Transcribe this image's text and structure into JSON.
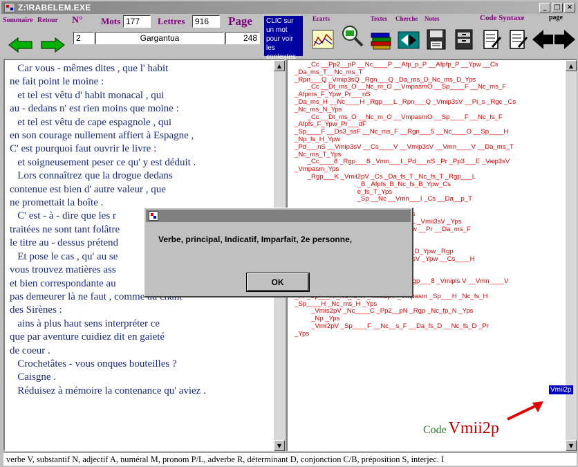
{
  "window": {
    "title": "Z:\\RABELEM.EXE",
    "controls": [
      "_",
      "□",
      "×"
    ]
  },
  "toolbar": {
    "sommaire_label": "Sommaire",
    "retour_label": "Retour",
    "numero_label": "N°",
    "mots_label": "Mots",
    "mots_value": "177",
    "lettres_label": "Lettres",
    "lettres_value": "916",
    "page_label": "Page",
    "numero_value": "2",
    "book_value": "Gargantua",
    "page_value": "248",
    "clic_text": "CLIC sur un mot pour voir les contextes",
    "ecarts_label": "Ecarts",
    "textes_label": "Textes",
    "cherche_label": "Cherche",
    "notes_label": "Notes",
    "code_syntaxe_label": "Code Syntaxe",
    "page_small_label": "page"
  },
  "left_text": {
    "lines": [
      "   Car vous - mêmes dites , que l' habit",
      "ne fait point le moine :",
      "   et tel est vêtu d' habit monacal , qui",
      "au - dedans n' est rien moins que moine :",
      "   et tel est vêtu de cape espagnole , qui",
      "en son courage nullement affiert à Espagne ,",
      "C' est pourquoi faut ouvrir le livre :",
      "   et soigneusement peser ce qu' y est déduit .",
      "   Lors connaîtrez que la drogue dedans",
      "contenue est bien d' autre valeur , que",
      "ne promettait la boîte .",
      "   C' est - à - dire que les r",
      "traitées ne sont tant folâtre",
      "le titre au - dessus prétend",
      "   Et pose le cas , qu' au se",
      "vous trouvez matières ass",
      "et bien correspondante au",
      "pas demeurer là ne faut , comme au chant",
      "des Sirènes :",
      "   ains à plus haut sens interpréter ce",
      "que par aventure cuidiez dit en gaieté",
      "de coeur .",
      "   Crochetâtes - vous onques bouteilles ?",
      "   Caisgne .",
      "   Réduisez à mémoire la contenance qu' aviez ."
    ]
  },
  "code_text": {
    "lines": [
      "       _Cc __Pp2__pP __Nc____P __Afp_p_P __Afpfp_P __Ypw __Cs",
      "_Da_ms_T__Nc_ms_T",
      "_Rpn___Q _Vmip3sQ _Rgn___Q _Da_ms_D_Nc_ms_D_Yps",
      "       _Cc __Dt_ms_O __Nc_m_O __VmpasmO __Sp____F __Nc_ms_F",
      "_Afpms_F_Ypw_Pr___nS",
      "_Da_ms_H __Nc____H _Rgp___L _Rpn___Q _Vmip3sV __Pi_s _Rgc _Cs",
      "_Nc_ms_N_Yps",
      "       _Cc __Dt_ms_O __Nc_m_O __VmpasmO __Sp____F __Nc_fs_F",
      "_Afpfs_F_Ypw_Pr___dF",
      "_Sp____F __Ds3_ssF __Nc_ms_F __Rgn___5 __Nc____O __Sp____H",
      "_Np_fs_H_Ypw",
      "_Pd___nS __Vmip3sV __Cs____V __Vmip3sV __Vmn____V __Da_ms_T",
      "_Nc_ms_T_Yps",
      "       _Cc____8 _Rgp___8 _Vmn___I _Pd___nS _Pr _Pp3___E _Vaip3sV",
      "_Vmpasm_Yps",
      "       _Rgp___K _Vmii2pV _Cs _Da_fs_T _Nc_fs_T _Rgp___L",
      "                                  _B _Afpfs_B_Nc_fs_B_Ypw_Cs",
      "                                  e_fs_T_Yps",
      "                                  _Sp __Nc __Vmn___I _Cs __Da__p_T",
      "",
      "                                  gp _Afp_p_Ypw_Cs",
      "                                  Nc____H_Rgp___L _Vmii3sV _Yps",
      "                                  T __Nc_m_T __Ypw __Pr __Da_ms_F",
      "",
      "                                  gp____D _Afpfp_D",
      "                                  Da_ms_D_Nc_ms_D_Ypw _Rgp",
      "                                  _Rpn___8 _Vmip3sV _Ypw __Cs____H",
      "_Da_ms_H_Nc_ms_H",
      "_Da__p_H_Np_fp_H_Yps",
      "       _Cc____8 _Sp____8 _Rgn___8 _Rgp___8 _Vmipls V __Vmn____V",
      "_Pd___nT",
      "_Pr _Sp___H _Nc_fs_H _Vmii2pV _Vmpasm _Sp___H _Nc_fs_H",
      "_Sp____H _Nc_ms_H _Yps",
      "         _Vmis2pV _Nc____C _Pp2__pN _Rgp _Nc_fp_N _Yps",
      "         _Np _Yps",
      "         _Vmr2pV _Sp____F __Nc__s_F __Da_fs_D __Nc_fs_D _Pr",
      "_Yps"
    ],
    "highlight": "Vmii2p"
  },
  "annotation": {
    "prefix": "Code",
    "code": "Vmii2p"
  },
  "dialog": {
    "message": "Verbe, principal, Indicatif, Imparfait, 2e personne,",
    "ok_label": "OK"
  },
  "status": {
    "text": "verbe V, substantif N, adjectif A, numéral M, pronom P/L, adverbe R, déterminant D, conjonction C/B, préposition S, interjec. I"
  },
  "colors": {
    "accent_purple": "#800080",
    "code_red": "#e00000",
    "text_blue": "#1a2a80",
    "highlight_blue": "#0000c0"
  }
}
